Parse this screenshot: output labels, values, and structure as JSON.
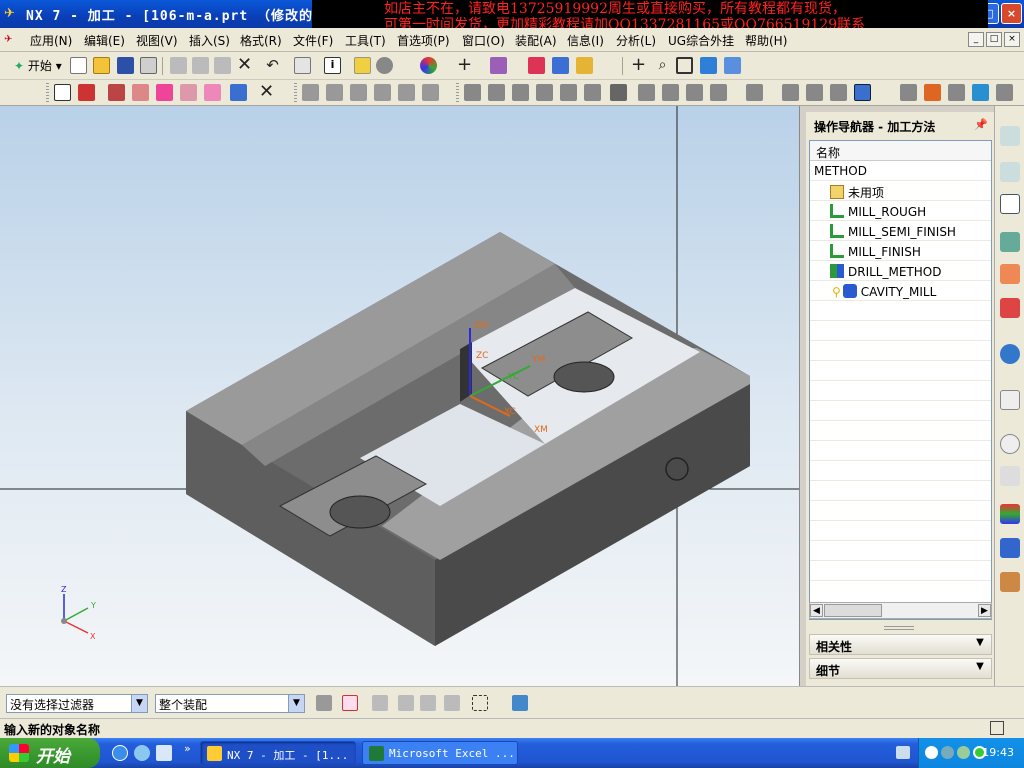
{
  "window": {
    "title": "NX 7 - 加工 - [106-m-a.prt （修改的）",
    "controls": [
      "_",
      "□",
      "×"
    ]
  },
  "banner": {
    "line1": "如店主不在，请致电13725919992周生或直接购买，所有教程都有现货，",
    "line2": "可第一时间发货，更加精彩教程请加QQ1337281165或QQ766519129联系"
  },
  "menubar": {
    "items": [
      {
        "label": "应用(N)"
      },
      {
        "label": "编辑(E)"
      },
      {
        "label": "视图(V)"
      },
      {
        "label": "插入(S)"
      },
      {
        "label": "格式(R)"
      },
      {
        "label": "文件(F)"
      },
      {
        "label": "工具(T)"
      },
      {
        "label": "首选项(P)"
      },
      {
        "label": "窗口(O)"
      },
      {
        "label": "装配(A)"
      },
      {
        "label": "信息(I)"
      },
      {
        "label": "分析(L)"
      },
      {
        "label": "UG综合外挂"
      },
      {
        "label": "帮助(H)"
      }
    ]
  },
  "toolbar": {
    "start_label": "开始"
  },
  "viewport": {
    "wcs_labels": {
      "zm": "ZM",
      "yc": "YC",
      "ym": "YM",
      "xc": "XC",
      "xm": "XM",
      "zc": "ZC"
    },
    "triad_labels": {
      "z": "Z",
      "y": "Y",
      "x": "X"
    }
  },
  "navigator": {
    "title": "操作导航器 - 加工方法",
    "column_header": "名称",
    "rows": [
      {
        "label": "METHOD",
        "level": 0,
        "icon": "root"
      },
      {
        "label": "未用项",
        "level": 1,
        "icon": "folder-icon"
      },
      {
        "label": "MILL_ROUGH",
        "level": 1,
        "icon": "mill-method-icon"
      },
      {
        "label": "MILL_SEMI_FINISH",
        "level": 1,
        "icon": "mill-method-icon"
      },
      {
        "label": "MILL_FINISH",
        "level": 1,
        "icon": "mill-method-icon"
      },
      {
        "label": "DRILL_METHOD",
        "level": 1,
        "icon": "drill-method-icon"
      },
      {
        "label": "CAVITY_MILL",
        "level": 2,
        "icon": "cavity-mill-icon"
      }
    ],
    "sections": [
      {
        "label": "相关性"
      },
      {
        "label": "细节"
      }
    ]
  },
  "filterbar": {
    "selection_filter": "没有选择过滤器",
    "scope": "整个装配"
  },
  "status": {
    "message": "输入新的对象名称"
  },
  "taskbar": {
    "start_label": "开始",
    "tasks": [
      {
        "label": "NX 7 - 加工 - [1..."
      },
      {
        "label": "Microsoft Excel ..."
      }
    ],
    "clock": "19:43"
  },
  "colors": {
    "titlebar": "#0a4fc8",
    "banner_text": "#ff2020",
    "model_gray": "#7a7a7a",
    "wcs_orange": "#e06a1c",
    "wcs_blue": "#2a2ae0"
  }
}
